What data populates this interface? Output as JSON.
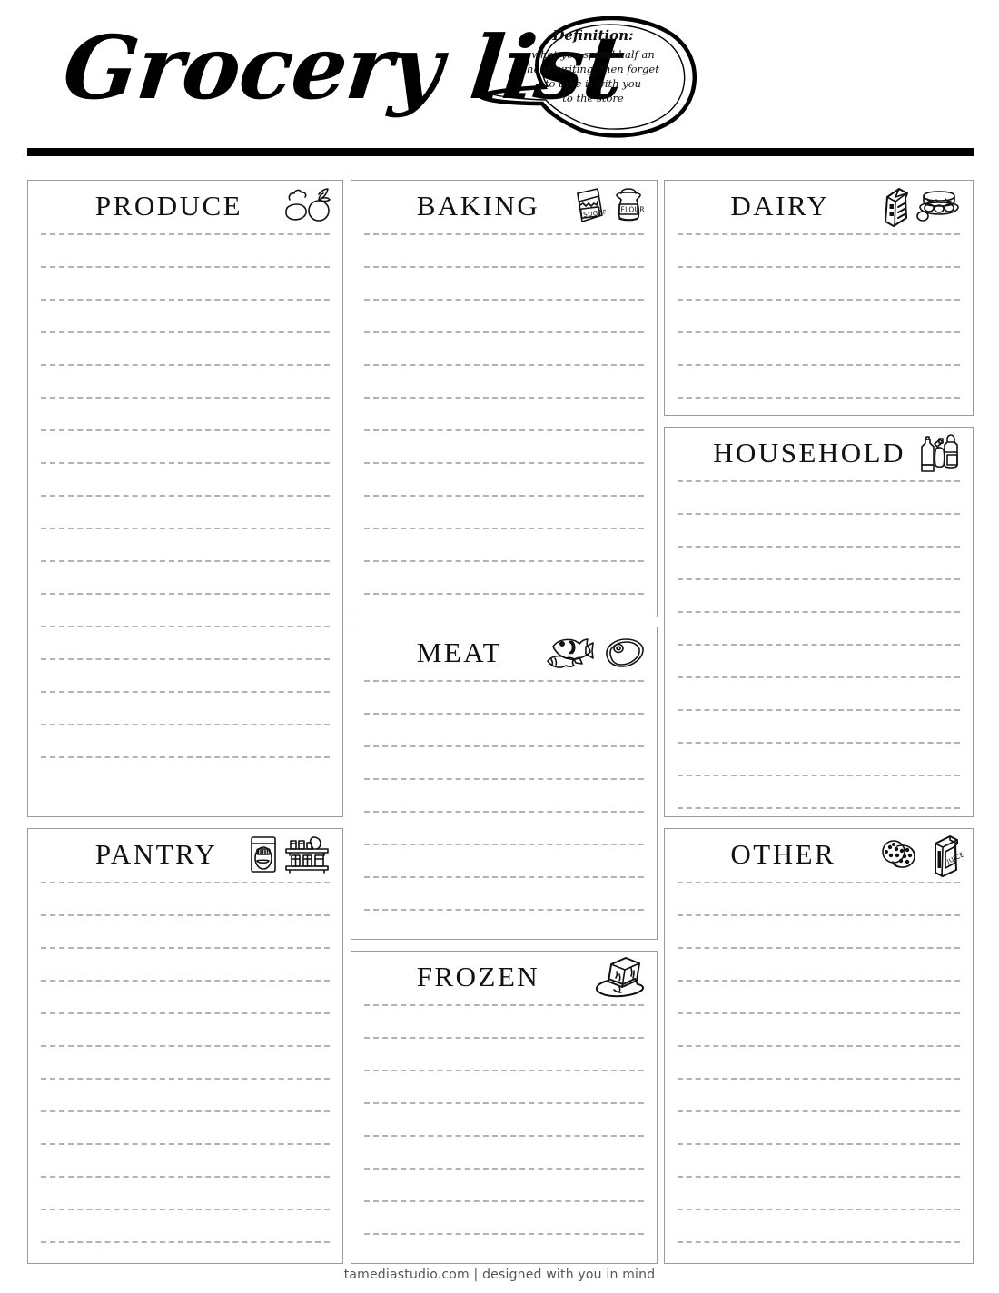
{
  "header": {
    "title": "Grocery list",
    "bubble": {
      "heading": "Definition:",
      "line1": "what you spend half an",
      "line2": "hour writing, then forget",
      "line3": "to take it with you",
      "line4": "to the store"
    }
  },
  "footer": {
    "text": "tamediastudio.com  |  designed with you in mind"
  },
  "colors": {
    "ink": "#000000",
    "rule": "#000000",
    "box_border": "#9a9a9a",
    "writing_line": "#b2b2b2",
    "footer_text": "#555555",
    "paper": "#ffffff"
  },
  "sections": [
    {
      "id": "produce",
      "title": "PRODUCE",
      "icons": [
        "fruit-vegetables-icon"
      ],
      "line_count": 17,
      "column": "left"
    },
    {
      "id": "pantry",
      "title": "PANTRY",
      "icons": [
        "cereal-box-icon",
        "pantry-shelf-icon"
      ],
      "line_count": 12,
      "column": "left"
    },
    {
      "id": "baking",
      "title": "BAKING",
      "icons": [
        "sugar-bag-icon",
        "flour-bag-icon"
      ],
      "icon_labels": [
        "SUGAR",
        "FLOUR"
      ],
      "line_count": 12,
      "column": "middle"
    },
    {
      "id": "meat",
      "title": "MEAT",
      "icons": [
        "fish-icon",
        "steak-icon"
      ],
      "line_count": 8,
      "column": "middle"
    },
    {
      "id": "frozen",
      "title": "FROZEN",
      "icons": [
        "melting-ice-cube-icon"
      ],
      "line_count": 8,
      "column": "middle"
    },
    {
      "id": "dairy",
      "title": "DAIRY",
      "icons": [
        "milk-carton-icon",
        "egg-carton-icon"
      ],
      "line_count": 6,
      "column": "right"
    },
    {
      "id": "household",
      "title": "HOUSEHOLD",
      "icons": [
        "cleaning-bottles-icon"
      ],
      "line_count": 11,
      "column": "right"
    },
    {
      "id": "other",
      "title": "OTHER",
      "icons": [
        "cookies-icon",
        "juice-carton-icon"
      ],
      "icon_labels": [
        "JUICE"
      ],
      "line_count": 12,
      "column": "right"
    }
  ]
}
